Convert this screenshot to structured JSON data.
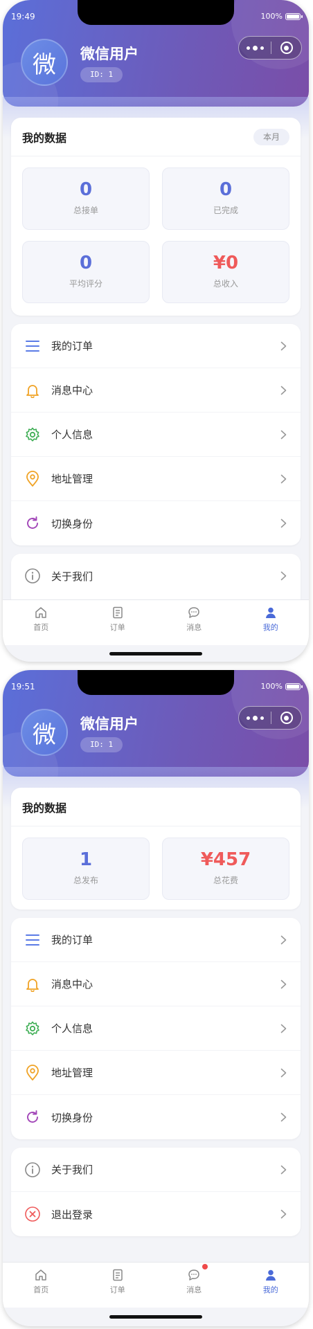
{
  "screens": [
    {
      "status": {
        "time": "19:49",
        "battery": "100%",
        "battery_level": 1.0
      },
      "user": {
        "avatar_char": "微",
        "name": "微信用户",
        "id_text": "ID: 1"
      },
      "stats": {
        "title": "我的数据",
        "period": "本月",
        "items": [
          {
            "value": "0",
            "label": "总接单"
          },
          {
            "value": "0",
            "label": "已完成"
          },
          {
            "value": "0",
            "label": "平均评分"
          },
          {
            "value": "¥0",
            "label": "总收入"
          }
        ]
      },
      "menu": [
        {
          "label": "我的订单",
          "icon": "list-icon"
        },
        {
          "label": "消息中心",
          "icon": "bell-icon"
        },
        {
          "label": "个人信息",
          "icon": "gear-icon"
        },
        {
          "label": "地址管理",
          "icon": "location-icon"
        },
        {
          "label": "切换身份",
          "icon": "refresh-icon"
        }
      ],
      "menu2": [
        {
          "label": "关于我们",
          "icon": "info-icon"
        }
      ],
      "tabs": [
        {
          "label": "首页",
          "icon": "home-icon"
        },
        {
          "label": "订单",
          "icon": "order-icon"
        },
        {
          "label": "消息",
          "icon": "message-icon"
        },
        {
          "label": "我的",
          "icon": "person-icon",
          "active": true
        }
      ]
    },
    {
      "status": {
        "time": "19:51",
        "battery": "100%",
        "battery_level": 1.0
      },
      "user": {
        "avatar_char": "微",
        "name": "微信用户",
        "id_text": "ID: 1"
      },
      "stats": {
        "title": "我的数据",
        "items": [
          {
            "value": "1",
            "label": "总发布"
          },
          {
            "value": "¥457",
            "label": "总花费"
          }
        ]
      },
      "menu": [
        {
          "label": "我的订单",
          "icon": "list-icon"
        },
        {
          "label": "消息中心",
          "icon": "bell-icon"
        },
        {
          "label": "个人信息",
          "icon": "gear-icon"
        },
        {
          "label": "地址管理",
          "icon": "location-icon"
        },
        {
          "label": "切换身份",
          "icon": "refresh-icon"
        }
      ],
      "menu2": [
        {
          "label": "关于我们",
          "icon": "info-icon"
        },
        {
          "label": "退出登录",
          "icon": "logout-icon"
        }
      ],
      "tabs": [
        {
          "label": "首页",
          "icon": "home-icon"
        },
        {
          "label": "订单",
          "icon": "order-icon"
        },
        {
          "label": "消息",
          "icon": "message-icon",
          "unread": true
        },
        {
          "label": "我的",
          "icon": "person-icon",
          "active": true
        }
      ]
    }
  ],
  "colors": {
    "accent": "#5b6fd9",
    "header_start": "#5b6fd9",
    "header_end": "#7a4ea8",
    "money_red": "#ef5a5a",
    "tab_active": "#4a6ad8",
    "badge_red": "#ef4a4a"
  }
}
